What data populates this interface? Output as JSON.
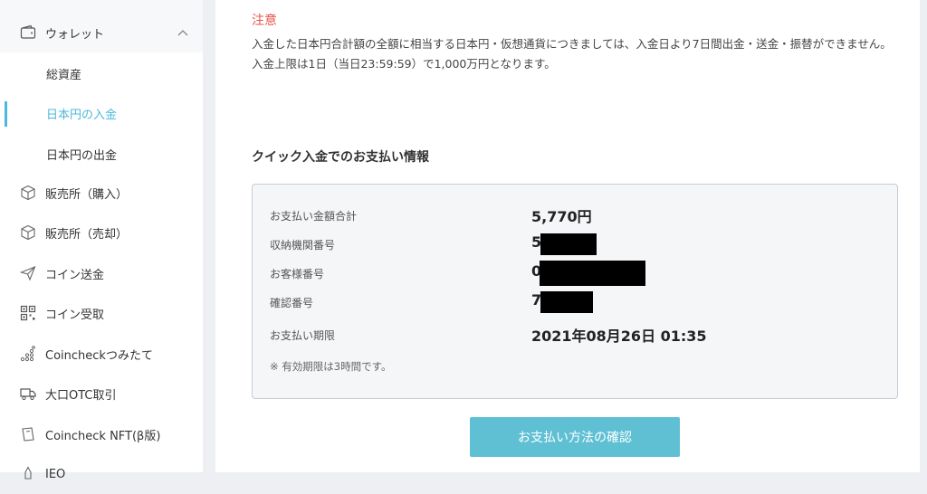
{
  "sidebar": {
    "wallet": {
      "label": "ウォレット",
      "icon": "wallet-icon"
    },
    "wallet_sub": [
      {
        "label": "総資産"
      },
      {
        "label": "日本円の入金",
        "active": true
      },
      {
        "label": "日本円の出金"
      }
    ],
    "items": [
      {
        "label": "販売所（購入）",
        "icon": "cube-icon"
      },
      {
        "label": "販売所（売却）",
        "icon": "cube-icon"
      },
      {
        "label": "コイン送金",
        "icon": "paper-plane-icon"
      },
      {
        "label": "コイン受取",
        "icon": "qr-code-icon"
      },
      {
        "label": "Coincheckつみたて",
        "icon": "coin-stack-icon"
      },
      {
        "label": "大口OTC取引",
        "icon": "truck-icon"
      },
      {
        "label": "Coincheck NFT(β版)",
        "icon": "nft-icon"
      },
      {
        "label": "IEO",
        "icon": "rocket-icon"
      }
    ]
  },
  "notice": {
    "title": "注意",
    "line1": "入金した日本円合計額の全額に相当する日本円・仮想通貨につきましては、入金日より7日間出金・送金・振替ができません。",
    "line2": "入金上限は1日（当日23:59:59）で1,000万円となります。"
  },
  "payment": {
    "title": "クイック入金でのお支払い情報",
    "rows": [
      {
        "label": "お支払い金額合計",
        "value": "5,770円"
      },
      {
        "label": "収納機関番号",
        "value": "5"
      },
      {
        "label": "お客様番号",
        "value": "0"
      },
      {
        "label": "確認番号",
        "value": "7"
      },
      {
        "label": "お支払い期限",
        "value": "2021年08月26日 01:35"
      }
    ],
    "note": "※ 有効期限は3時間です。",
    "button": "お支払い方法の確認"
  },
  "colors": {
    "accent": "#4cb8db",
    "warning": "#e8534d",
    "button": "#5fc0d4"
  }
}
